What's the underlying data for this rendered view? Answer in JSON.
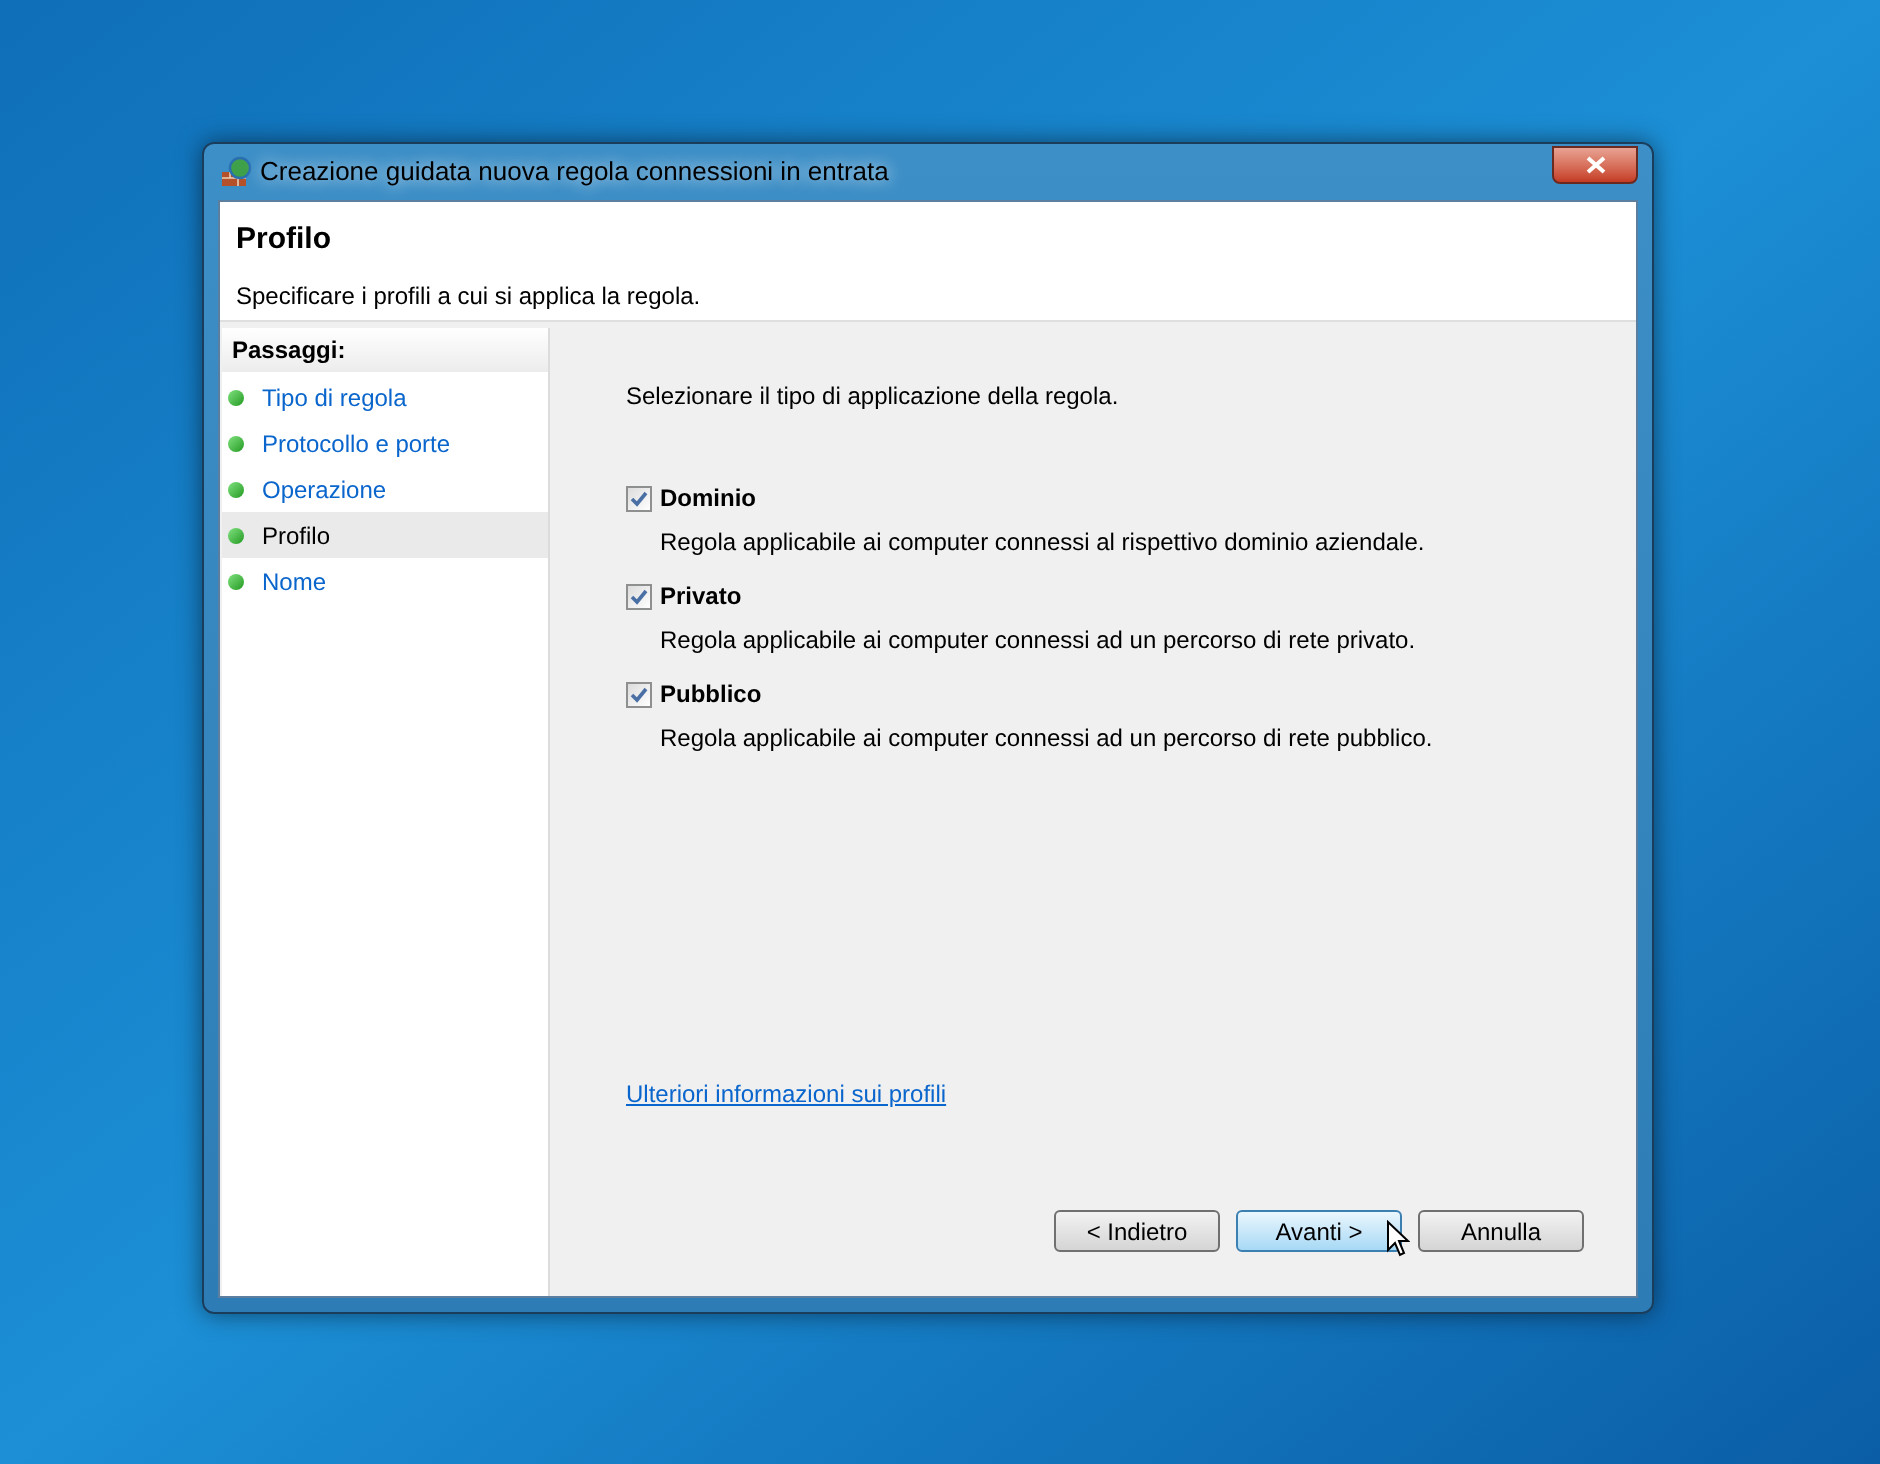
{
  "window": {
    "title": "Creazione guidata nuova regola connessioni in entrata"
  },
  "header": {
    "title": "Profilo",
    "subtitle": "Specificare i profili a cui si applica la regola."
  },
  "sidebar": {
    "title": "Passaggi:",
    "items": [
      {
        "label": "Tipo di regola",
        "selected": false
      },
      {
        "label": "Protocollo e porte",
        "selected": false
      },
      {
        "label": "Operazione",
        "selected": false
      },
      {
        "label": "Profilo",
        "selected": true
      },
      {
        "label": "Nome",
        "selected": false
      }
    ]
  },
  "content": {
    "prompt": "Selezionare il tipo di applicazione della regola.",
    "options": [
      {
        "label": "Dominio",
        "description": "Regola applicabile ai computer connessi al rispettivo dominio aziendale.",
        "checked": true
      },
      {
        "label": "Privato",
        "description": "Regola applicabile ai computer connessi ad un percorso di rete privato.",
        "checked": true
      },
      {
        "label": "Pubblico",
        "description": "Regola applicabile ai computer connessi ad un percorso di rete pubblico.",
        "checked": true
      }
    ],
    "link": "Ulteriori informazioni sui profili"
  },
  "buttons": [
    {
      "label": "< Indietro",
      "hovered": false
    },
    {
      "label": "Avanti >",
      "hovered": true
    },
    {
      "label": "Annulla",
      "hovered": false
    }
  ]
}
